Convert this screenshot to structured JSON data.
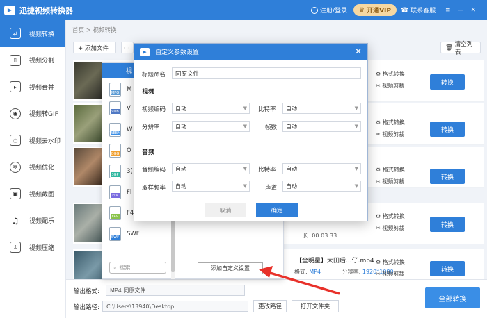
{
  "titlebar": {
    "app_title": "迅捷视频转换器",
    "login": "注册/登录",
    "vip": "开通VIP",
    "service": "联系客服"
  },
  "sidebar": {
    "items": [
      {
        "label": "视频转换",
        "icon": "convert-icon"
      },
      {
        "label": "视频分割",
        "icon": "split-icon"
      },
      {
        "label": "视频合并",
        "icon": "merge-icon"
      },
      {
        "label": "视频转GIF",
        "icon": "gif-icon"
      },
      {
        "label": "视频去水印",
        "icon": "watermark-icon"
      },
      {
        "label": "视频优化",
        "icon": "optimize-icon"
      },
      {
        "label": "视频截图",
        "icon": "screenshot-icon"
      },
      {
        "label": "视频配乐",
        "icon": "music-icon"
      },
      {
        "label": "视频压缩",
        "icon": "compress-icon"
      }
    ]
  },
  "main": {
    "breadcrumb_home": "首页",
    "breadcrumb_sep": ">",
    "breadcrumb_current": "视频转换",
    "add_file": "+ 添加文件",
    "clear_list": "清空列表",
    "row_format_btn": "格式转换",
    "row_clip_btn": "视频剪裁",
    "row_convert": "转换",
    "row4_meta": "长: 00:03:33",
    "row5_title": "【全明星】大田后...仔.mp4",
    "row5_format_label": "格式:",
    "row5_format": "MP4",
    "row5_res_label": "分辨率:",
    "row5_res": "1920*1080"
  },
  "format_panel": {
    "tab": "视",
    "items": [
      {
        "ext": "MPG",
        "label": "M",
        "color": "#5b9bd5"
      },
      {
        "ext": "VOB",
        "label": "V",
        "color": "#4f78c4"
      },
      {
        "ext": "WEBM",
        "label": "W",
        "color": "#3a8ee6"
      },
      {
        "ext": "OGG",
        "label": "O",
        "color": "#f0a030"
      },
      {
        "ext": "3GP",
        "label": "3(",
        "color": "#2fb8a0"
      },
      {
        "ext": "FLV",
        "label": "Fl",
        "color": "#7a6be0"
      },
      {
        "ext": "F4V",
        "label": "F4",
        "color": "#8ac34a"
      },
      {
        "ext": "SWF",
        "label": "SWF",
        "color": "#2f7fd9"
      }
    ],
    "search_placeholder": "搜索",
    "add_custom": "添加自定义设置"
  },
  "dialog": {
    "title": "自定义参数设置",
    "name_label": "标题命名",
    "name_value": "同原文件",
    "video_section": "视频",
    "video_codec_label": "视频编码",
    "video_codec_value": "自动",
    "bitrate_label": "比特率",
    "bitrate_value": "自动",
    "resolution_label": "分辨率",
    "resolution_value": "自动",
    "fps_label": "帧数",
    "fps_value": "自动",
    "audio_section": "音频",
    "audio_codec_label": "音频编码",
    "audio_codec_value": "自动",
    "audio_bitrate_label": "比特率",
    "audio_bitrate_value": "自动",
    "sample_rate_label": "取样频率",
    "sample_rate_value": "自动",
    "channel_label": "声道",
    "channel_value": "自动",
    "cancel": "取消",
    "ok": "确定"
  },
  "bottom": {
    "output_format_label": "输出格式:",
    "output_format_value": "MP4  同原文件",
    "output_path_label": "输出路径:",
    "output_path_value": "C:\\Users\\13940\\Desktop",
    "change_path": "更改路径",
    "open_folder": "打开文件夹",
    "convert_all": "全部转换"
  },
  "colors": {
    "accent": "#2f7fd9",
    "arrow": "#e8312a"
  }
}
